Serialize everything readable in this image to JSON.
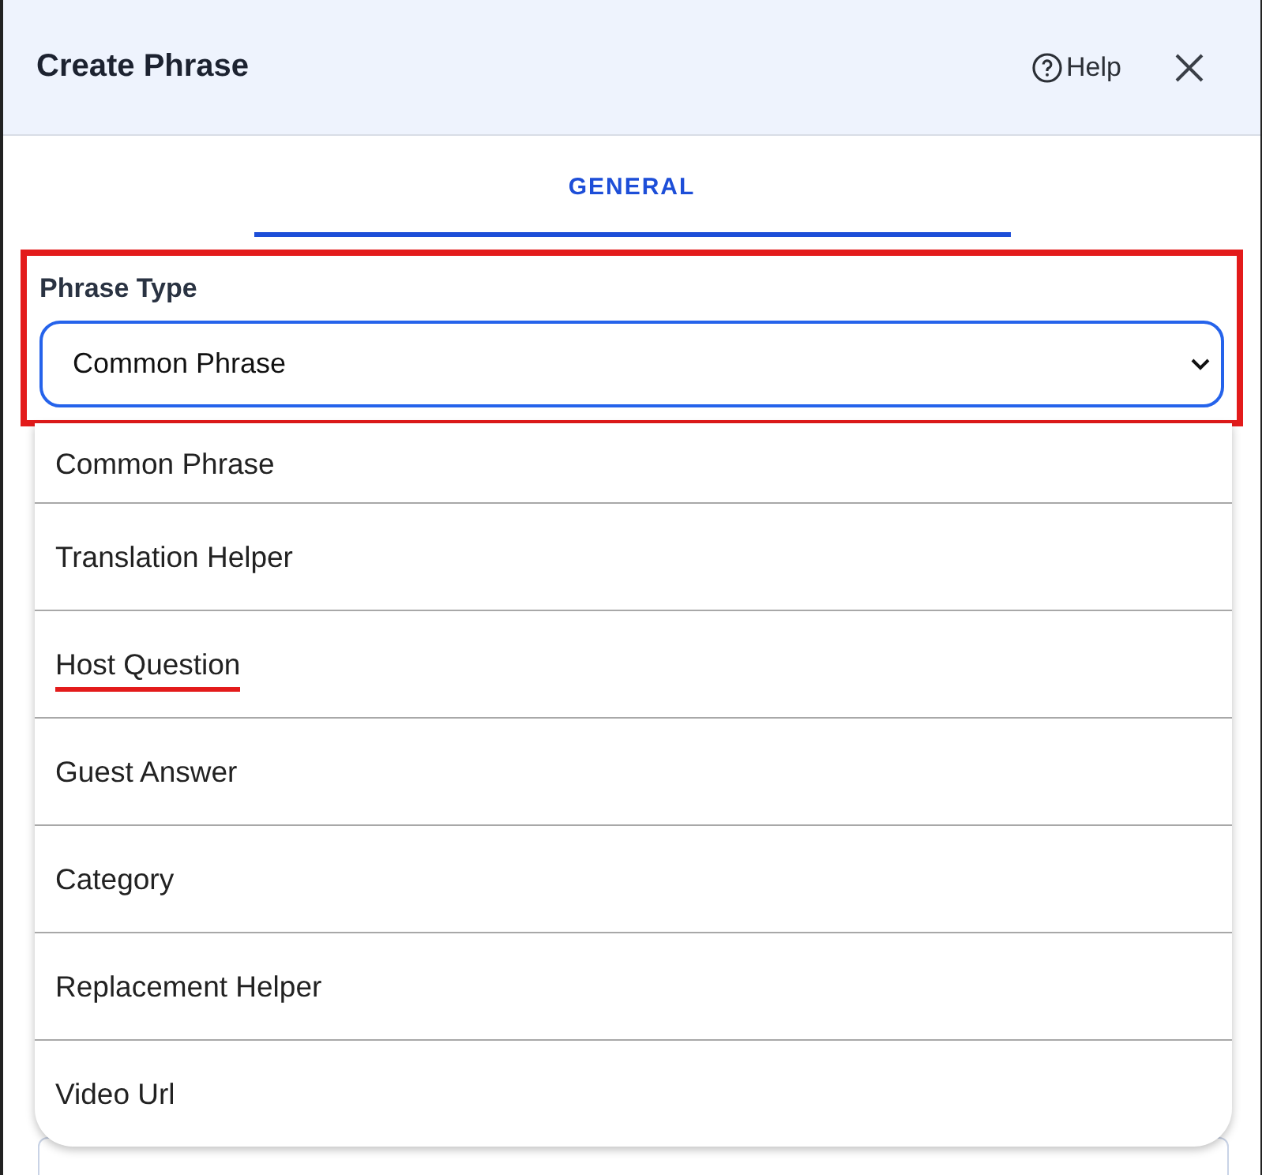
{
  "window": {
    "title": "Create Phrase",
    "help": "Help"
  },
  "tabs": [
    {
      "label": "GENERAL",
      "selected": true
    }
  ],
  "field": {
    "label": "Phrase Type",
    "value": "Common Phrase",
    "highlighted": true
  },
  "options": [
    {
      "label": "Common Phrase",
      "underlined": false
    },
    {
      "label": "Translation Helper",
      "underlined": false
    },
    {
      "label": "Host Question",
      "underlined": true
    },
    {
      "label": "Guest Answer",
      "underlined": false
    },
    {
      "label": "Category",
      "underlined": false
    },
    {
      "label": "Replacement Helper",
      "underlined": false
    },
    {
      "label": "Video Url",
      "underlined": false
    }
  ]
}
